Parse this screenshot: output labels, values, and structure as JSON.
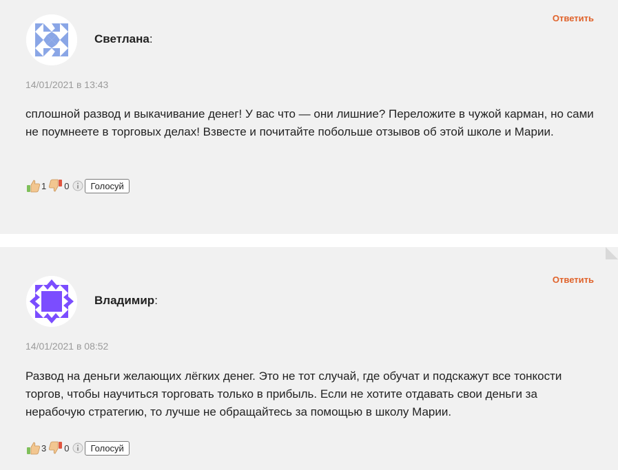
{
  "comments": [
    {
      "author": "Светлана",
      "colon": ":",
      "reply_label": "Ответить",
      "date": "14/01/2021 в 13:43",
      "text": "сплошной развод и выкачивание денег! У вас что — они лишние? Переложите в чужой карман, но сами не поумнеете в торговых делах! Взвесте и почитайте побольше отзывов об этой школе и Марии.",
      "likes": "1",
      "dislikes": "0",
      "vote_label": "Голосуй",
      "avatar_color": "#8aa6e6"
    },
    {
      "author": "Владимир",
      "colon": ":",
      "reply_label": "Ответить",
      "date": "14/01/2021 в 08:52",
      "text": "Развод на деньги желающих лёгких денег. Это не тот случай, где обучат и подскажут все тонкости торгов, чтобы научиться торговать только в прибыль. Если не хотите отдавать свои деньги за нерабочую стратегию, то лучше не обращайтесь за помощью в школу Марии.",
      "likes": "3",
      "dislikes": "0",
      "vote_label": "Голосуй",
      "avatar_color": "#7b4dff"
    }
  ],
  "icons": {
    "like": "thumbs-up-icon",
    "dislike": "thumbs-down-icon",
    "info": "info-icon"
  },
  "colors": {
    "reply": "#e0622a",
    "card_bg": "#f1f1f1",
    "date": "#9a9a9a"
  }
}
